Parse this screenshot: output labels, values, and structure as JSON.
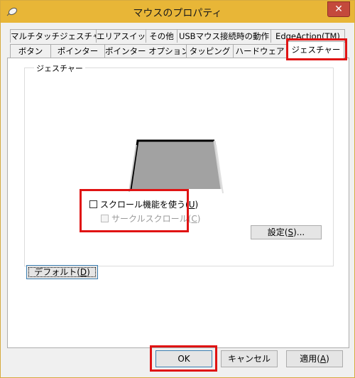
{
  "window": {
    "title": "マウスのプロパティ",
    "close_glyph": "✕"
  },
  "tabs": {
    "row1": [
      {
        "label": "マルチタッチジェスチャー"
      },
      {
        "label": "エリアスイッチ"
      },
      {
        "label": "その他"
      },
      {
        "label": "USBマウス接続時の動作"
      },
      {
        "label": "EdgeAction(TM)"
      }
    ],
    "row2": [
      {
        "label": "ボタン"
      },
      {
        "label": "ポインター"
      },
      {
        "label": "ポインター オプション"
      },
      {
        "label": "タッピング"
      },
      {
        "label": "ハードウェア"
      },
      {
        "label": "ジェスチャー"
      }
    ],
    "active": "ジェスチャー"
  },
  "gesture_group": {
    "label": "ジェスチャー",
    "scroll_checkbox": {
      "label": "スクロール機能を使う(",
      "accel": "U",
      "suffix": ")",
      "checked": false
    },
    "circle_scroll_checkbox": {
      "label": "サークルスクロール(",
      "accel": "C",
      "suffix": ")",
      "checked": false,
      "disabled": true
    },
    "settings_button": {
      "label": "設定(",
      "accel": "S",
      "suffix": ")..."
    }
  },
  "default_button": {
    "label": "デフォルト(",
    "accel": "D",
    "suffix": ")"
  },
  "footer": {
    "ok_label": "OK",
    "cancel_label": "キャンセル",
    "apply_label": "適用(",
    "apply_accel": "A",
    "apply_suffix": ")"
  },
  "colors": {
    "titlebar": "#e8b637",
    "highlight": "#e01313",
    "close_button": "#c44a3c"
  }
}
